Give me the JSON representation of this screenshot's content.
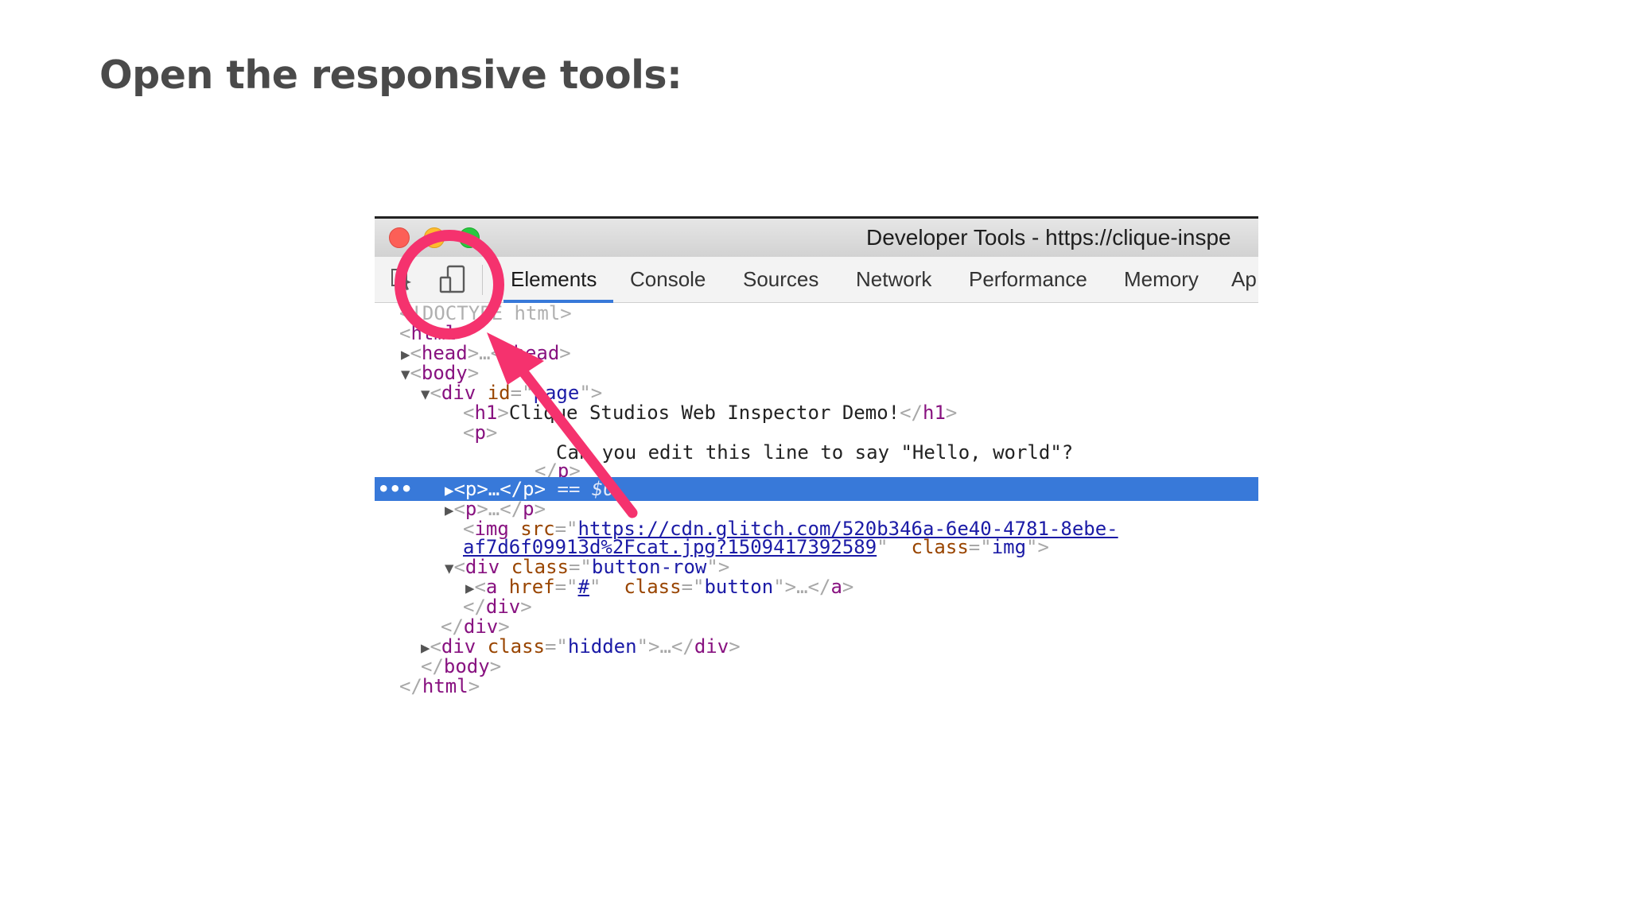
{
  "slide": {
    "title": "Open the responsive tools:"
  },
  "window": {
    "title": "Developer Tools - https://clique-inspe"
  },
  "tabs": [
    {
      "label": "Elements",
      "active": true
    },
    {
      "label": "Console"
    },
    {
      "label": "Sources"
    },
    {
      "label": "Network"
    },
    {
      "label": "Performance"
    },
    {
      "label": "Memory"
    },
    {
      "label": "Ap"
    }
  ],
  "toolbar": {
    "inspect_icon": "cursor-select-icon",
    "device_icon": "device-toggle-icon"
  },
  "code": {
    "doctype": "<!DOCTYPE html>",
    "l1_open": "<",
    "l1_tag": "html",
    "l1_close": ">",
    "l2_open": "<",
    "l2_tag": "head",
    "l2_mid": ">…</",
    "l2_tag2": "head",
    "l2_close": ">",
    "l3_open": "<",
    "l3_tag": "body",
    "l3_close": ">",
    "l4_open": "<",
    "l4_tag": "div",
    "l4_attr": " id",
    "l4_eq": "=\"",
    "l4_val": "page",
    "l4_close": "\">",
    "l5_open": "<",
    "l5_tag": "h1",
    "l5_mid": ">",
    "l5_text": "Clique Studios Web Inspector Demo!",
    "l5_end": "</",
    "l5_tag2": "h1",
    "l5_close": ">",
    "l6_open": "<",
    "l6_tag": "p",
    "l6_close": ">",
    "l7_text": "Can you edit this line to say \"Hello, world\"?",
    "l8_open": "</",
    "l8_tag": "p",
    "l8_close": ">",
    "l9_dots": "•••",
    "l9_open": "<",
    "l9_tag": "p",
    "l9_mid": ">…</",
    "l9_tag2": "p",
    "l9_close": ">",
    "l9_ref": " == $0",
    "l10_open": "<",
    "l10_tag": "p",
    "l10_mid": ">…</",
    "l10_tag2": "p",
    "l10_close": ">",
    "l11_open": "<",
    "l11_tag": "img",
    "l11_attr": " src",
    "l11_eq": "=\"",
    "l11_link": "https://cdn.glitch.com/520b346a-6e40-4781-8ebe-",
    "l12_link": "af7d6f09913d%2Fcat.jpg?1509417392589",
    "l12_q": "\"",
    "l12_attr": "  class",
    "l12_eq": "=\"",
    "l12_val": "img",
    "l12_close": "\">",
    "l13_open": "<",
    "l13_tag": "div",
    "l13_attr": " class",
    "l13_eq": "=\"",
    "l13_val": "button-row",
    "l13_close": "\">",
    "l14_open": "<",
    "l14_tag": "a",
    "l14_attr": " href",
    "l14_eq": "=\"",
    "l14_link": "#",
    "l14_q": "\"",
    "l14_attr2": "  class",
    "l14_eq2": "=\"",
    "l14_val": "button",
    "l14_mid": "\">…</",
    "l14_tag2": "a",
    "l14_close": ">",
    "l15_open": "</",
    "l15_tag": "div",
    "l15_close": ">",
    "l16_open": "</",
    "l16_tag": "div",
    "l16_close": ">",
    "l17_open": "<",
    "l17_tag": "div",
    "l17_attr": " class",
    "l17_eq": "=\"",
    "l17_val": "hidden",
    "l17_mid": "\">…</",
    "l17_tag2": "div",
    "l17_close": ">",
    "l18_open": "</",
    "l18_tag": "body",
    "l18_close": ">",
    "l19_open": "</",
    "l19_tag": "html",
    "l19_close": ">"
  },
  "annotation": {
    "circle_color": "#f5326e",
    "arrow_color": "#f5326e"
  }
}
